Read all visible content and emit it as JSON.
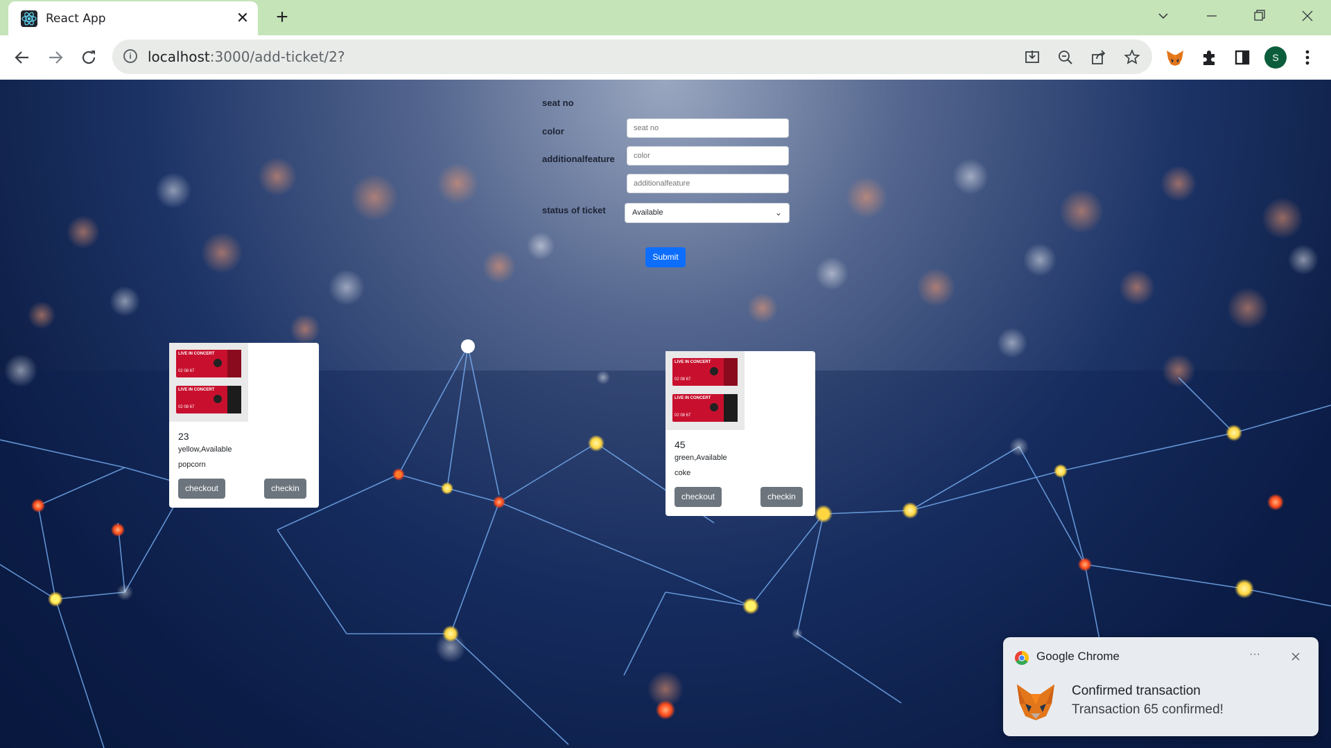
{
  "browser": {
    "tab_title": "React App",
    "url_host": "localhost",
    "url_path": ":3000/add-ticket/2?",
    "profile_initial": "S",
    "toolbar_icons": [
      "install-icon",
      "zoom-out-icon",
      "share-icon",
      "bookmark-star-icon"
    ],
    "extensions": [
      "metamask-fox-icon",
      "puzzle-extensions-icon",
      "side-panel-icon"
    ]
  },
  "form": {
    "seat_label": "seat no",
    "seat_placeholder": "seat no",
    "color_label": "color",
    "color_placeholder": "color",
    "feature_label": "additionalfeature",
    "feature_placeholder": "additionalfeature",
    "status_label": "status of ticket",
    "status_value": "Available",
    "submit_label": "Submit"
  },
  "tickets": [
    {
      "seat": "23",
      "details": "yellow,Available",
      "feature": "popcorn",
      "checkout_label": "checkout",
      "checkin_label": "checkin"
    },
    {
      "seat": "45",
      "details": "green,Available",
      "feature": "coke",
      "checkout_label": "checkout",
      "checkin_label": "checkin"
    }
  ],
  "ticket_image": {
    "line1": "LIVE IN CONCERT",
    "numbers": "02 08 67"
  },
  "notification": {
    "app_name": "Google Chrome",
    "title": "Confirmed transaction",
    "message": "Transaction 65 confirmed!",
    "more_label": "···"
  },
  "colors": {
    "accent": "#0d6efd",
    "secondary": "#6c757d",
    "tab_strip": "#c5e4b8"
  }
}
